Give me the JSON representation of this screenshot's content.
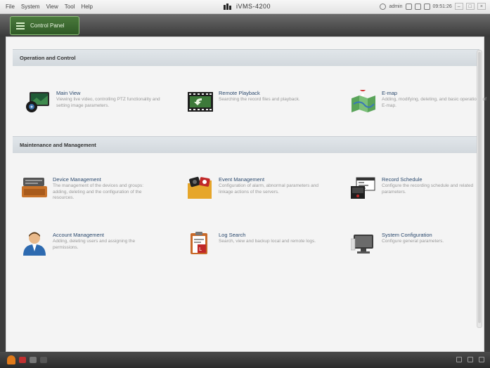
{
  "menu": [
    "File",
    "System",
    "View",
    "Tool",
    "Help"
  ],
  "app": {
    "title": "iVMS-4200"
  },
  "tray": {
    "user": "admin",
    "time": "09:51:26"
  },
  "tab": {
    "label": "Control Panel"
  },
  "sections": [
    {
      "title": "Operation and Control",
      "modules": [
        {
          "title": "Main View",
          "desc": "Viewing live video, controlling PTZ functionality and setting image parameters.",
          "icon": "main-view-icon"
        },
        {
          "title": "Remote Playback",
          "desc": "Searching the record files and playback.",
          "icon": "remote-playback-icon"
        },
        {
          "title": "E-map",
          "desc": "Adding, modifying, deleting, and basic operations of E-map.",
          "icon": "emap-icon"
        }
      ]
    },
    {
      "title": "Maintenance and Management",
      "modules": [
        {
          "title": "Device Management",
          "desc": "The management of the devices and groups: adding, deleting and the configuration of the resources.",
          "icon": "device-management-icon"
        },
        {
          "title": "Event Management",
          "desc": "Configuration of alarm, abnormal parameters and linkage actions of the servers.",
          "icon": "event-management-icon"
        },
        {
          "title": "Record Schedule",
          "desc": "Configure the recording schedule and related parameters.",
          "icon": "record-schedule-icon"
        },
        {
          "title": "Account Management",
          "desc": "Adding, deleting users and assigning the permissions.",
          "icon": "account-management-icon"
        },
        {
          "title": "Log Search",
          "desc": "Search, view and backup local and remote logs.",
          "icon": "log-search-icon"
        },
        {
          "title": "System Configuration",
          "desc": "Configure general parameters.",
          "icon": "system-configuration-icon"
        }
      ]
    }
  ],
  "colors": {
    "tab_active": "#3e6b33",
    "section_header": "#d8dde1",
    "module_title": "#2c4a6e"
  }
}
